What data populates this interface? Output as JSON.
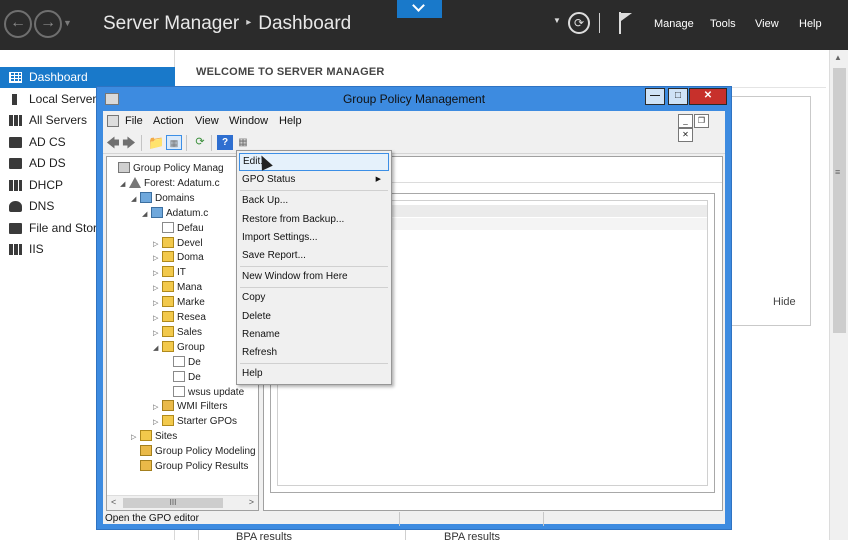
{
  "topbar": {
    "title": "Server Manager",
    "separator": "▸",
    "page": "Dashboard",
    "menu": [
      "Manage",
      "Tools",
      "View",
      "Help"
    ],
    "icons": [
      "back-icon",
      "forward-icon",
      "refresh-icon",
      "flag-icon"
    ]
  },
  "sidebar": {
    "items": [
      {
        "label": "Dashboard",
        "icon": "dashboard-icon"
      },
      {
        "label": "Local Server",
        "icon": "server-icon"
      },
      {
        "label": "All Servers",
        "icon": "servers-icon"
      },
      {
        "label": "AD CS",
        "icon": "ad-cs-icon"
      },
      {
        "label": "AD DS",
        "icon": "ad-ds-icon"
      },
      {
        "label": "DHCP",
        "icon": "dhcp-icon"
      },
      {
        "label": "DNS",
        "icon": "dns-icon"
      },
      {
        "label": "File and Stora",
        "icon": "file-storage-icon"
      },
      {
        "label": "IIS",
        "icon": "iis-icon"
      }
    ]
  },
  "dashboard": {
    "welcome": "WELCOME TO SERVER MANAGER",
    "hide": "Hide",
    "bpa_1": "BPA results",
    "bpa_2": "BPA results"
  },
  "gpmc": {
    "title": "Group Policy Management",
    "menu": [
      "File",
      "Action",
      "View",
      "Window",
      "Help"
    ],
    "tree": [
      {
        "label": "Group Policy Manag",
        "depth": 0,
        "exp": "",
        "icon": "tree"
      },
      {
        "label": "Forest: Adatum.c",
        "depth": 1,
        "exp": "◢",
        "icon": "forest"
      },
      {
        "label": "Domains",
        "depth": 2,
        "exp": "◢",
        "icon": "domain"
      },
      {
        "label": "Adatum.c",
        "depth": 3,
        "exp": "◢",
        "icon": "domain"
      },
      {
        "label": "Defau",
        "depth": 4,
        "exp": "",
        "icon": "gpo"
      },
      {
        "label": "Devel",
        "depth": 4,
        "exp": "▷",
        "icon": "ou"
      },
      {
        "label": "Doma",
        "depth": 4,
        "exp": "▷",
        "icon": "ou"
      },
      {
        "label": "IT",
        "depth": 4,
        "exp": "▷",
        "icon": "ou"
      },
      {
        "label": "Mana",
        "depth": 4,
        "exp": "▷",
        "icon": "ou"
      },
      {
        "label": "Marke",
        "depth": 4,
        "exp": "▷",
        "icon": "ou"
      },
      {
        "label": "Resea",
        "depth": 4,
        "exp": "▷",
        "icon": "ou"
      },
      {
        "label": "Sales",
        "depth": 4,
        "exp": "▷",
        "icon": "ou"
      },
      {
        "label": "Group",
        "depth": 4,
        "exp": "◢",
        "icon": "ou"
      },
      {
        "label": "De",
        "depth": 5,
        "exp": "",
        "icon": "gpo"
      },
      {
        "label": "De",
        "depth": 5,
        "exp": "",
        "icon": "gpo"
      },
      {
        "label": "wsus update",
        "depth": 5,
        "exp": "",
        "icon": "gpo"
      },
      {
        "label": "WMI Filters",
        "depth": 4,
        "exp": "▷",
        "icon": "wmi"
      },
      {
        "label": "Starter GPOs",
        "depth": 4,
        "exp": "▷",
        "icon": "ou"
      },
      {
        "label": "Sites",
        "depth": 2,
        "exp": "▷",
        "icon": "ou"
      },
      {
        "label": "Group Policy Modeling",
        "depth": 2,
        "exp": "",
        "icon": "wmi"
      },
      {
        "label": "Group Policy Results",
        "depth": 2,
        "exp": "",
        "icon": "wmi"
      }
    ],
    "hscroll_thumb": "III",
    "status": "Open the GPO editor"
  },
  "context_menu": [
    {
      "label": "Edit...",
      "highlight": true
    },
    {
      "label": "GPO Status",
      "submenu": true
    },
    {
      "sep": true
    },
    {
      "label": "Back Up..."
    },
    {
      "label": "Restore from Backup..."
    },
    {
      "label": "Import Settings..."
    },
    {
      "label": "Save Report..."
    },
    {
      "sep": true
    },
    {
      "label": "New Window from Here"
    },
    {
      "sep": true
    },
    {
      "label": "Copy"
    },
    {
      "label": "Delete"
    },
    {
      "label": "Rename"
    },
    {
      "label": "Refresh"
    },
    {
      "sep": true
    },
    {
      "label": "Help"
    }
  ],
  "colors": {
    "topbar_bg": "#2b2b2b",
    "accent": "#1979ca",
    "window_frame": "#3d8be0",
    "close_button": "#c7302b"
  }
}
